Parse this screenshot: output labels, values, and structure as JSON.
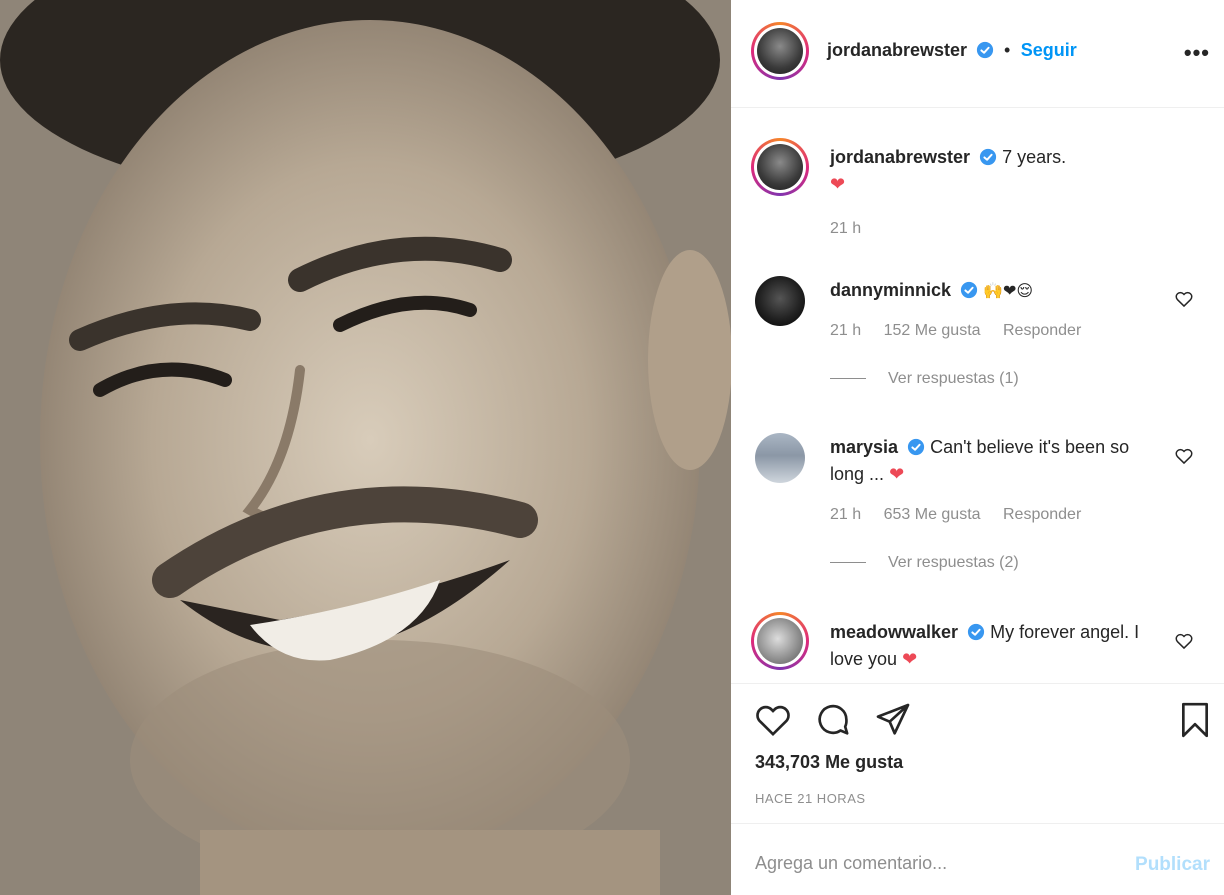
{
  "header": {
    "username": "jordanabrewster",
    "dot": "•",
    "follow_label": "Seguir",
    "more_label": "•••"
  },
  "caption": {
    "username": "jordanabrewster",
    "text": "7 years.",
    "emoji": "❤",
    "time": "21 h"
  },
  "comments": [
    {
      "username": "dannyminnick",
      "text": "",
      "emoji": "🙌❤😌",
      "time": "21 h",
      "likes": "152 Me gusta",
      "reply_label": "Responder",
      "view_replies": "Ver respuestas (1)"
    },
    {
      "username": "marysia",
      "text": "Can't believe it's been so long ...",
      "emoji": "❤",
      "time": "21 h",
      "likes": "653 Me gusta",
      "reply_label": "Responder",
      "view_replies": "Ver respuestas (2)"
    },
    {
      "username": "meadowwalker",
      "text": "My forever angel. I love you",
      "emoji": "❤"
    }
  ],
  "post": {
    "likes": "343,703 Me gusta",
    "posted": "HACE 21 HORAS"
  },
  "composer": {
    "placeholder": "Agrega un comentario...",
    "publish_label": "Publicar"
  },
  "colors": {
    "accent": "#0095f6",
    "verified": "#3897f0",
    "heart": "#ed4956"
  },
  "icons": [
    "verified-icon",
    "more-icon",
    "heart-icon",
    "comment-icon",
    "share-icon",
    "bookmark-icon"
  ]
}
